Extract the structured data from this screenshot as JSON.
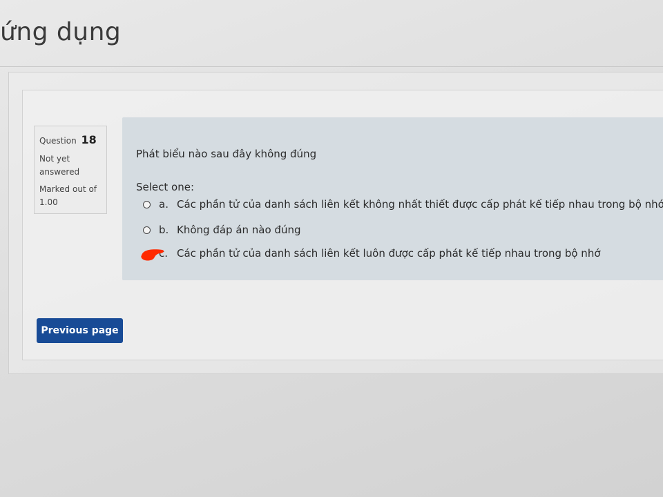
{
  "page": {
    "title": "ứng dụng"
  },
  "question_info": {
    "label": "Question",
    "number": "18",
    "state": "Not yet answered",
    "grade": "Marked out of 1.00"
  },
  "question": {
    "text": "Phát biểu nào sau đây không đúng",
    "prompt": "Select one:",
    "options": [
      {
        "letter": "a.",
        "text": "Các phần tử của danh sách liên kết không nhất thiết được cấp phát kế tiếp nhau trong bộ nhớ"
      },
      {
        "letter": "b.",
        "text": "Không đáp án nào đúng"
      },
      {
        "letter": "c.",
        "text": "Các phần tử của danh sách liên kết luôn được cấp phát kế tiếp nhau trong bộ nhớ"
      }
    ]
  },
  "navigation": {
    "previous_label": "Previous page"
  },
  "colors": {
    "button_bg": "#184b96",
    "question_bg": "#d5dce1",
    "scribble": "#ff2a00"
  }
}
